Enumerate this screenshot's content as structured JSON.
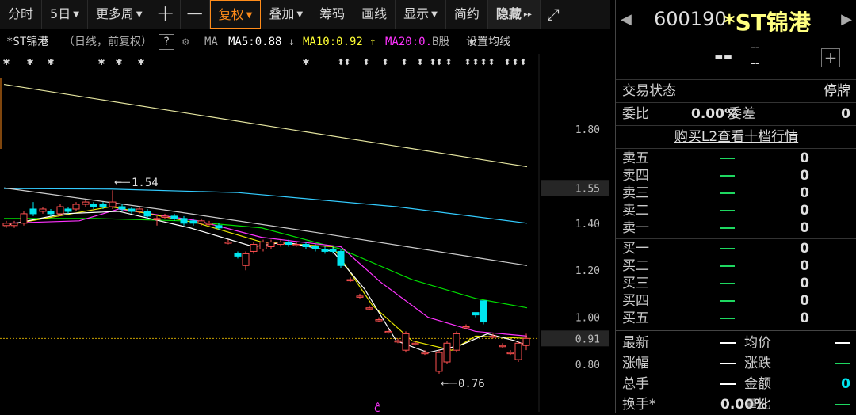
{
  "toolbar": {
    "items": [
      "分时",
      "5日",
      "更多周",
      "十",
      "一",
      "复权",
      "叠加",
      "筹码",
      "画线",
      "显示",
      "简约",
      "隐藏"
    ],
    "dropdown_idx": [
      1,
      2,
      5,
      6,
      9
    ],
    "active_idx": 5,
    "fullscreen": "⤢"
  },
  "chart_header": {
    "title": "*ST锦港",
    "sub": "（日线，前复权）",
    "help": "?",
    "ma_label": "MA",
    "ma5": "MA5:0.88 ↓",
    "ma10": "MA10:0.92 ↑",
    "ma20": "MA20:0.",
    "bgu": "B股",
    "setting": "设置均线"
  },
  "chart_data": {
    "type": "candlestick",
    "y_ticks": [
      "1.80",
      "1.55",
      "1.40",
      "1.20",
      "1.00",
      "0.91",
      "0.80"
    ],
    "y_tick_values": [
      1.8,
      1.55,
      1.4,
      1.2,
      1.0,
      0.91,
      0.8
    ],
    "highlight_ticks": [
      "1.55",
      "0.91"
    ],
    "annotations": [
      {
        "text": "1.54",
        "value": 1.54
      },
      {
        "text": "0.76",
        "value": 0.76
      }
    ],
    "ma": [
      {
        "name": "MA5",
        "value": 0.88
      },
      {
        "name": "MA10",
        "value": 0.92
      }
    ],
    "colors": {
      "up": "#ff5050",
      "down": "#00e6f0",
      "ma5": "#ffffff",
      "ma10": "#e6e600",
      "ma20": "#ff33ff",
      "ma30": "#00dd00",
      "ma60": "#cccccc",
      "ma120": "#33ccff",
      "ma250": "#e6e6a0"
    }
  },
  "quote": {
    "code": "600190",
    "name": "*ST锦港",
    "price": "--",
    "change": "--",
    "change_pct": "--",
    "add": "+"
  },
  "status": {
    "label": "交易状态",
    "value": "停牌"
  },
  "ratio": {
    "label": "委比",
    "value": "0.00%",
    "label2": "委差",
    "value2": "0"
  },
  "l2_link": "购买L2查看十档行情",
  "sell": [
    {
      "label": "卖五",
      "vol": "0"
    },
    {
      "label": "卖四",
      "vol": "0"
    },
    {
      "label": "卖三",
      "vol": "0"
    },
    {
      "label": "卖二",
      "vol": "0"
    },
    {
      "label": "卖一",
      "vol": "0"
    }
  ],
  "buy": [
    {
      "label": "买一",
      "vol": "0"
    },
    {
      "label": "买二",
      "vol": "0"
    },
    {
      "label": "买三",
      "vol": "0"
    },
    {
      "label": "买四",
      "vol": "0"
    },
    {
      "label": "买五",
      "vol": "0"
    }
  ],
  "stats": [
    {
      "a": "最新",
      "b": "—",
      "c": "均价",
      "d": "—"
    },
    {
      "a": "涨幅",
      "b": "—",
      "c": "涨跌",
      "d": "—"
    },
    {
      "a": "总手",
      "b": "—",
      "c": "金额",
      "d": "0"
    },
    {
      "a": "换手*",
      "b": "0.00%",
      "c": "量比",
      "d": "—"
    }
  ]
}
